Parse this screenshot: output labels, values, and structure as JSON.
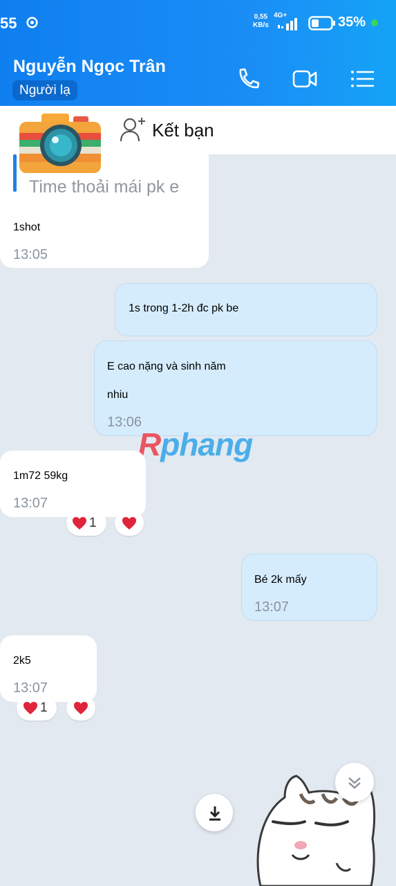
{
  "status_bar": {
    "time": "55",
    "speed": "0,55",
    "speed_unit": "KB/s",
    "network": "4G+",
    "battery": "35%"
  },
  "header": {
    "contact_name": "Nguyễn Ngọc Trân",
    "contact_badge": "Người lạ",
    "icons": [
      "phone-icon",
      "video-call-icon",
      "menu-icon"
    ]
  },
  "friend_bar": {
    "label": "Kết bạn"
  },
  "messages": [
    {
      "side": "in",
      "quote": "Time thoải mái pk e",
      "lines": [
        "1shot"
      ],
      "time": "13:05"
    },
    {
      "side": "out",
      "lines": [
        "1s trong 1-2h đc pk be"
      ],
      "time": ""
    },
    {
      "side": "out",
      "lines": [
        "E cao nặng và sinh năm",
        "nhiu"
      ],
      "time": "13:06"
    },
    {
      "side": "in",
      "lines": [
        "1m72 59kg"
      ],
      "time": "13:07",
      "reaction_count": "1"
    },
    {
      "side": "out",
      "lines": [
        "Bé 2k mấy"
      ],
      "time": "13:07"
    },
    {
      "side": "in",
      "lines": [
        "2k5"
      ],
      "time": "13:07",
      "reaction_count": "1"
    }
  ],
  "watermark": {
    "first": "R",
    "rest": "phang"
  },
  "colors": {
    "header": "#1a8cf5",
    "incoming_bubble": "#ffffff",
    "outgoing_bubble": "#d5ecfc",
    "chat_background": "#e2e9f1",
    "heart": "#e0243b"
  }
}
